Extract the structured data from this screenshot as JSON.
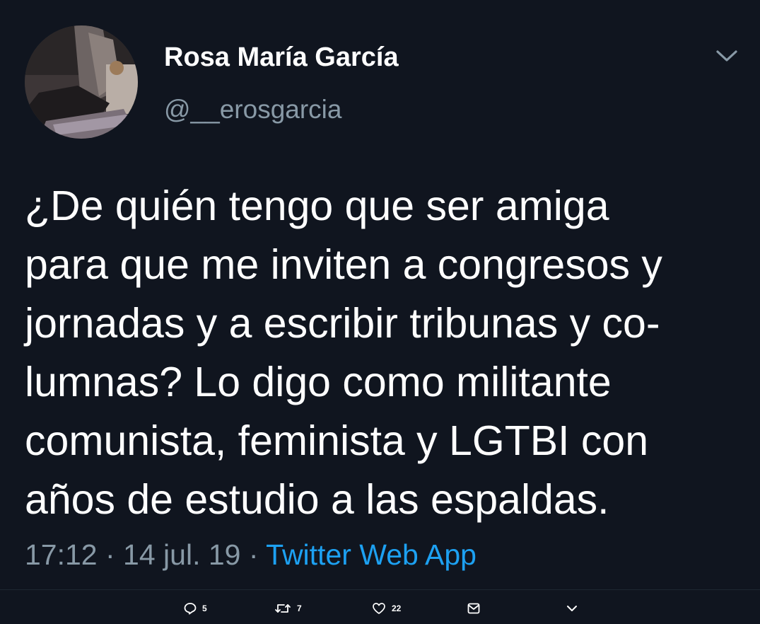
{
  "tweet": {
    "author_name": "Rosa María García",
    "author_handle": "@__erosgarcia",
    "avatar_icon": "user-avatar-photo",
    "text_lines": [
      "¿De quién tengo que ser amiga",
      "para que me inviten a congresos y",
      "jornadas y a escribir tribunas y co-",
      "lumnas? Lo digo como militante",
      "comunista, feminista y LGTBI con",
      "años de estudio a las espaldas."
    ],
    "time": "17:12",
    "separator": " · ",
    "date": "14 jul. 19",
    "source": "Twitter Web App"
  },
  "actions": {
    "reply_count": "5",
    "retweet_count": "7",
    "like_count": "22",
    "reply_icon": "reply-icon",
    "retweet_icon": "retweet-icon",
    "like_icon": "heart-icon",
    "dm_icon": "envelope-icon",
    "more_icon": "chevron-down-icon"
  },
  "colors": {
    "background": "#10151f",
    "text": "#ffffff",
    "secondary": "#8899a6",
    "link": "#1da1f2"
  }
}
